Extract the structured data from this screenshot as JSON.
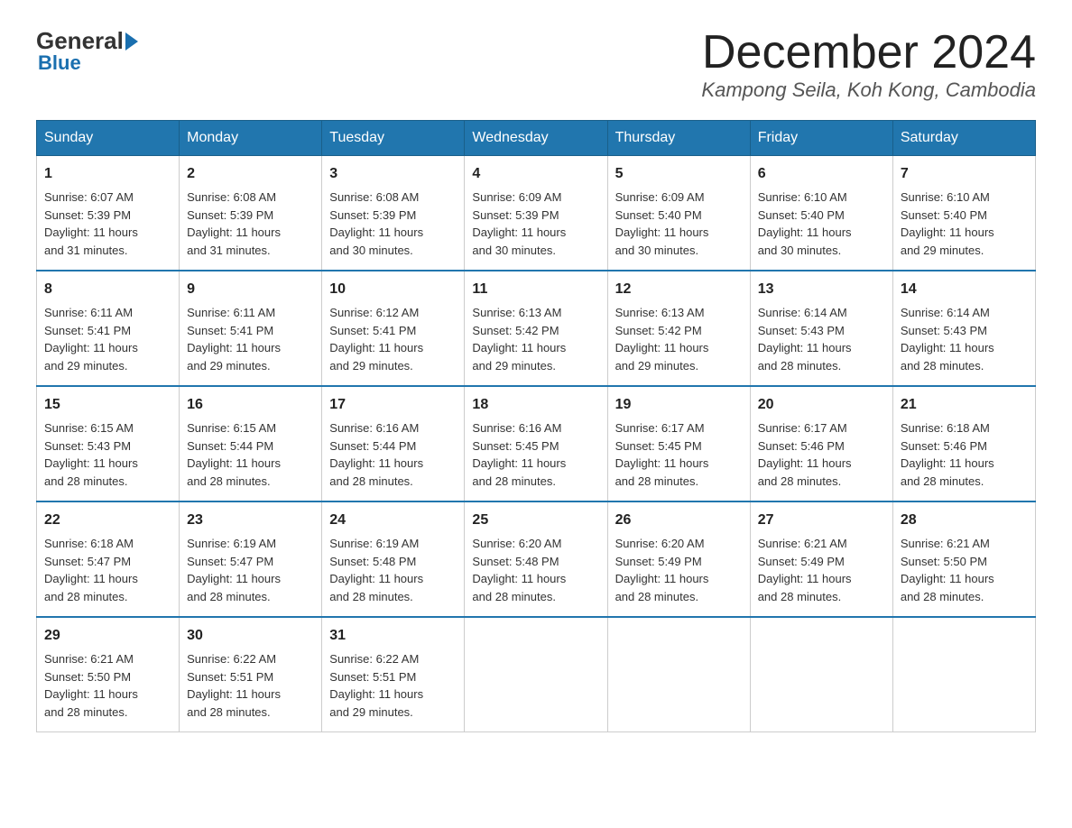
{
  "logo": {
    "general": "General",
    "blue": "Blue"
  },
  "title": "December 2024",
  "subtitle": "Kampong Seila, Koh Kong, Cambodia",
  "header": {
    "accent_color": "#2176ae"
  },
  "days_of_week": [
    "Sunday",
    "Monday",
    "Tuesday",
    "Wednesday",
    "Thursday",
    "Friday",
    "Saturday"
  ],
  "weeks": [
    [
      {
        "day": "1",
        "sunrise": "6:07 AM",
        "sunset": "5:39 PM",
        "daylight": "11 hours and 31 minutes."
      },
      {
        "day": "2",
        "sunrise": "6:08 AM",
        "sunset": "5:39 PM",
        "daylight": "11 hours and 31 minutes."
      },
      {
        "day": "3",
        "sunrise": "6:08 AM",
        "sunset": "5:39 PM",
        "daylight": "11 hours and 30 minutes."
      },
      {
        "day": "4",
        "sunrise": "6:09 AM",
        "sunset": "5:39 PM",
        "daylight": "11 hours and 30 minutes."
      },
      {
        "day": "5",
        "sunrise": "6:09 AM",
        "sunset": "5:40 PM",
        "daylight": "11 hours and 30 minutes."
      },
      {
        "day": "6",
        "sunrise": "6:10 AM",
        "sunset": "5:40 PM",
        "daylight": "11 hours and 30 minutes."
      },
      {
        "day": "7",
        "sunrise": "6:10 AM",
        "sunset": "5:40 PM",
        "daylight": "11 hours and 29 minutes."
      }
    ],
    [
      {
        "day": "8",
        "sunrise": "6:11 AM",
        "sunset": "5:41 PM",
        "daylight": "11 hours and 29 minutes."
      },
      {
        "day": "9",
        "sunrise": "6:11 AM",
        "sunset": "5:41 PM",
        "daylight": "11 hours and 29 minutes."
      },
      {
        "day": "10",
        "sunrise": "6:12 AM",
        "sunset": "5:41 PM",
        "daylight": "11 hours and 29 minutes."
      },
      {
        "day": "11",
        "sunrise": "6:13 AM",
        "sunset": "5:42 PM",
        "daylight": "11 hours and 29 minutes."
      },
      {
        "day": "12",
        "sunrise": "6:13 AM",
        "sunset": "5:42 PM",
        "daylight": "11 hours and 29 minutes."
      },
      {
        "day": "13",
        "sunrise": "6:14 AM",
        "sunset": "5:43 PM",
        "daylight": "11 hours and 28 minutes."
      },
      {
        "day": "14",
        "sunrise": "6:14 AM",
        "sunset": "5:43 PM",
        "daylight": "11 hours and 28 minutes."
      }
    ],
    [
      {
        "day": "15",
        "sunrise": "6:15 AM",
        "sunset": "5:43 PM",
        "daylight": "11 hours and 28 minutes."
      },
      {
        "day": "16",
        "sunrise": "6:15 AM",
        "sunset": "5:44 PM",
        "daylight": "11 hours and 28 minutes."
      },
      {
        "day": "17",
        "sunrise": "6:16 AM",
        "sunset": "5:44 PM",
        "daylight": "11 hours and 28 minutes."
      },
      {
        "day": "18",
        "sunrise": "6:16 AM",
        "sunset": "5:45 PM",
        "daylight": "11 hours and 28 minutes."
      },
      {
        "day": "19",
        "sunrise": "6:17 AM",
        "sunset": "5:45 PM",
        "daylight": "11 hours and 28 minutes."
      },
      {
        "day": "20",
        "sunrise": "6:17 AM",
        "sunset": "5:46 PM",
        "daylight": "11 hours and 28 minutes."
      },
      {
        "day": "21",
        "sunrise": "6:18 AM",
        "sunset": "5:46 PM",
        "daylight": "11 hours and 28 minutes."
      }
    ],
    [
      {
        "day": "22",
        "sunrise": "6:18 AM",
        "sunset": "5:47 PM",
        "daylight": "11 hours and 28 minutes."
      },
      {
        "day": "23",
        "sunrise": "6:19 AM",
        "sunset": "5:47 PM",
        "daylight": "11 hours and 28 minutes."
      },
      {
        "day": "24",
        "sunrise": "6:19 AM",
        "sunset": "5:48 PM",
        "daylight": "11 hours and 28 minutes."
      },
      {
        "day": "25",
        "sunrise": "6:20 AM",
        "sunset": "5:48 PM",
        "daylight": "11 hours and 28 minutes."
      },
      {
        "day": "26",
        "sunrise": "6:20 AM",
        "sunset": "5:49 PM",
        "daylight": "11 hours and 28 minutes."
      },
      {
        "day": "27",
        "sunrise": "6:21 AM",
        "sunset": "5:49 PM",
        "daylight": "11 hours and 28 minutes."
      },
      {
        "day": "28",
        "sunrise": "6:21 AM",
        "sunset": "5:50 PM",
        "daylight": "11 hours and 28 minutes."
      }
    ],
    [
      {
        "day": "29",
        "sunrise": "6:21 AM",
        "sunset": "5:50 PM",
        "daylight": "11 hours and 28 minutes."
      },
      {
        "day": "30",
        "sunrise": "6:22 AM",
        "sunset": "5:51 PM",
        "daylight": "11 hours and 28 minutes."
      },
      {
        "day": "31",
        "sunrise": "6:22 AM",
        "sunset": "5:51 PM",
        "daylight": "11 hours and 29 minutes."
      },
      null,
      null,
      null,
      null
    ]
  ],
  "labels": {
    "sunrise": "Sunrise:",
    "sunset": "Sunset:",
    "daylight": "Daylight:"
  }
}
